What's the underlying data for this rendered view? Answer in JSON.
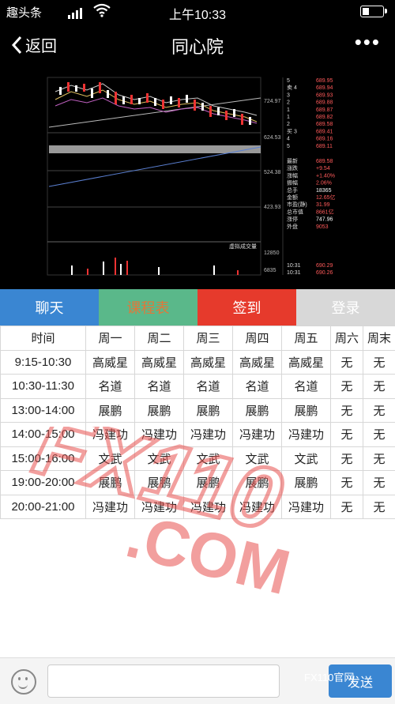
{
  "status_bar": {
    "app_name": "趣头条",
    "time": "上午10:33"
  },
  "navbar": {
    "back_label": "返回",
    "title": "同心院"
  },
  "chart": {
    "y_axis": [
      "724.97",
      "624.53",
      "524.38",
      "423.93",
      "12850",
      "6835"
    ],
    "legend": "虚拟成交量",
    "order_book": [
      {
        "label": "5",
        "price": "689.95"
      },
      {
        "label": "卖 4",
        "price": "689.94"
      },
      {
        "label": "3",
        "price": "689.93"
      },
      {
        "label": "2",
        "price": "689.88"
      },
      {
        "label": "1",
        "price": "689.87"
      },
      {
        "label": "1",
        "price": "689.82"
      },
      {
        "label": "2",
        "price": "689.58"
      },
      {
        "label": "买 3",
        "price": "689.41"
      },
      {
        "label": "4",
        "price": "689.16"
      },
      {
        "label": "5",
        "price": "689.11"
      }
    ],
    "stats": [
      {
        "label": "最新",
        "value": "689.58"
      },
      {
        "label": "涨跌",
        "value": "+9.54"
      },
      {
        "label": "涨幅",
        "value": "+1.40%"
      },
      {
        "label": "振幅",
        "value": "2.06%"
      },
      {
        "label": "总手",
        "value": "18365"
      },
      {
        "label": "金额",
        "value": "12.65亿"
      },
      {
        "label": "市盈(静)",
        "value": "31.99"
      },
      {
        "label": "总市值",
        "value": "8661亿"
      },
      {
        "label": "涨停",
        "value": "747.96"
      },
      {
        "label": "外盘",
        "value": "9053"
      }
    ],
    "ticks": [
      {
        "time": "10:31",
        "price": "690.29"
      },
      {
        "time": "10:31",
        "price": "690.26"
      }
    ]
  },
  "tabs": [
    {
      "label": "聊天"
    },
    {
      "label": "课程表"
    },
    {
      "label": "签到"
    },
    {
      "label": "登录"
    }
  ],
  "schedule": {
    "headers": [
      "时间",
      "周一",
      "周二",
      "周三",
      "周四",
      "周五",
      "周六",
      "周末"
    ],
    "rows": [
      [
        "9:15-10:30",
        "高威星",
        "高威星",
        "高威星",
        "高威星",
        "高威星",
        "无",
        "无"
      ],
      [
        "10:30-11:30",
        "名道",
        "名道",
        "名道",
        "名道",
        "名道",
        "无",
        "无"
      ],
      [
        "13:00-14:00",
        "展鹏",
        "展鹏",
        "展鹏",
        "展鹏",
        "展鹏",
        "无",
        "无"
      ],
      [
        "14:00-15:00",
        "冯建功",
        "冯建功",
        "冯建功",
        "冯建功",
        "冯建功",
        "无",
        "无"
      ],
      [
        "15:00-16:00",
        "文武",
        "文武",
        "文武",
        "文武",
        "文武",
        "无",
        "无"
      ],
      [
        "19:00-20:00",
        "展鹏",
        "展鹏",
        "展鹏",
        "展鹏",
        "展鹏",
        "无",
        "无"
      ],
      [
        "20:00-21:00",
        "冯建功",
        "冯建功",
        "冯建功",
        "冯建功",
        "冯建功",
        "无",
        "无"
      ]
    ]
  },
  "watermark": {
    "text1": "FX110",
    "text2": ".COM"
  },
  "bottom_bar": {
    "send_label": "发送",
    "corner_mark": "FX110官网"
  },
  "colors": {
    "chat_tab": "#3a86d2",
    "schedule_tab": "#5ab88a",
    "sign_tab": "#e63a2c",
    "login_tab": "#d8d8d8",
    "watermark": "#e8524f"
  }
}
